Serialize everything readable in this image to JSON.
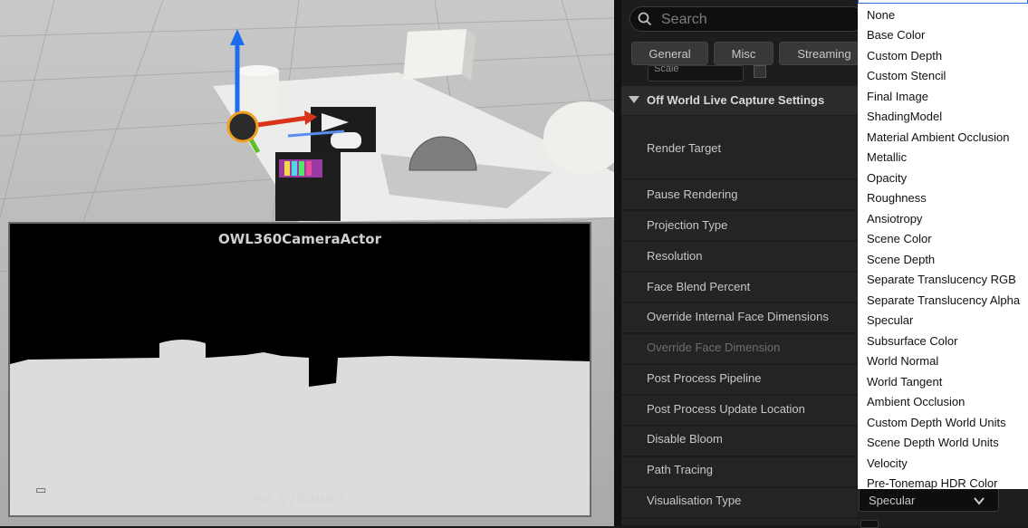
{
  "viewport": {
    "preview_title": "OWL360CameraActor",
    "preview_angle": "90.570099 °"
  },
  "details": {
    "search_placeholder": "Search",
    "filter_tabs": [
      "General",
      "Misc",
      "Streaming"
    ],
    "hidden_row_text": "Scale",
    "section_title": "Off World Live Capture Settings",
    "properties": [
      {
        "label": "Render Target",
        "disabled": false
      },
      {
        "label": "Pause Rendering",
        "disabled": false
      },
      {
        "label": "Projection Type",
        "disabled": false
      },
      {
        "label": "Resolution",
        "disabled": false
      },
      {
        "label": "Face Blend Percent",
        "disabled": false
      },
      {
        "label": "Override Internal Face Dimensions",
        "disabled": false
      },
      {
        "label": "Override Face Dimension",
        "disabled": true
      },
      {
        "label": "Post Process Pipeline",
        "disabled": false
      },
      {
        "label": "Post Process Update Location",
        "disabled": false
      },
      {
        "label": "Disable Bloom",
        "disabled": false
      },
      {
        "label": "Path Tracing",
        "disabled": false
      },
      {
        "label": "Visualisation Type",
        "disabled": false
      }
    ],
    "visualisation_value": "Specular"
  },
  "dropdown": {
    "options": [
      "None",
      "Base Color",
      "Custom Depth",
      "Custom Stencil",
      "Final Image",
      "ShadingModel",
      "Material Ambient Occlusion",
      "Metallic",
      "Opacity",
      "Roughness",
      "Ansiotropy",
      "Scene Color",
      "Scene Depth",
      "Separate Translucency RGB",
      "Separate Translucency Alpha",
      "Specular",
      "Subsurface Color",
      "World Normal",
      "World Tangent",
      "Ambient Occlusion",
      "Custom Depth World Units",
      "Scene Depth World Units",
      "Velocity",
      "Pre-Tonemap HDR Color"
    ]
  },
  "colors": {
    "panel_bg": "#1d1d1d",
    "row_bg": "#242424",
    "section_bg": "#2b2b2b",
    "dropdown_bg": "#ffffff",
    "focus_blue": "#2a6fd6"
  }
}
